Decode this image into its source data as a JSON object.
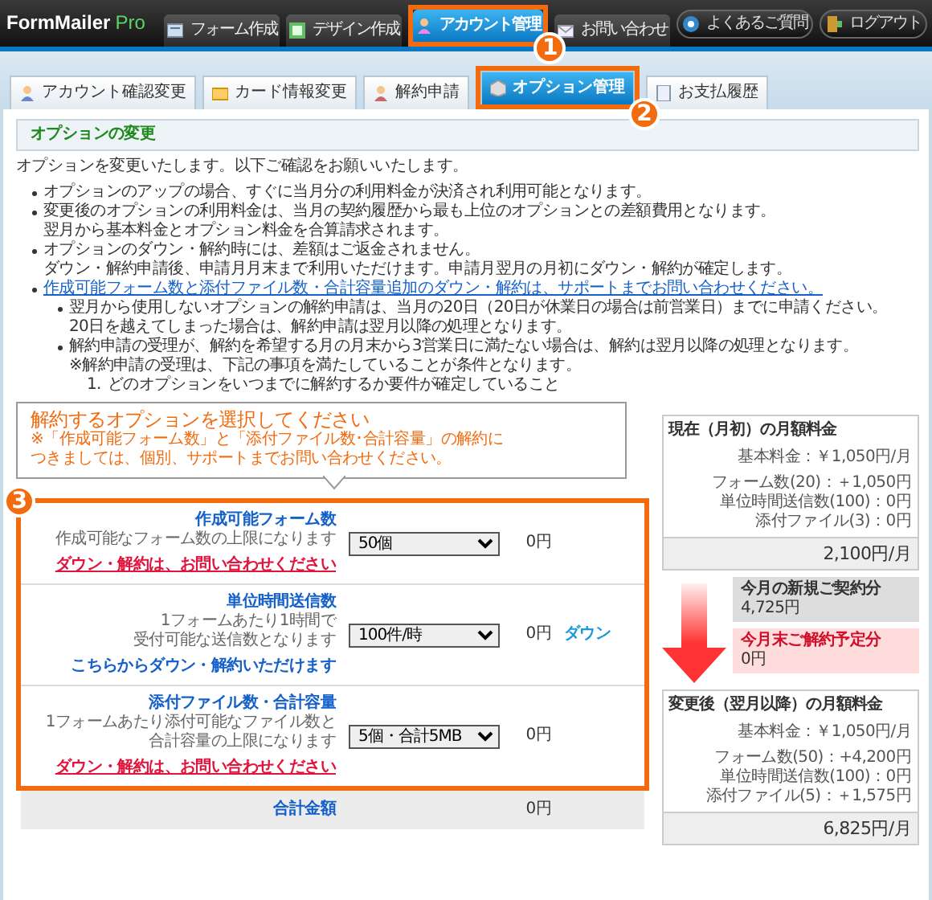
{
  "header": {
    "logo": {
      "main": "FormMailer",
      "suffix": "Pro"
    },
    "nav": [
      {
        "label": "フォーム作成",
        "selected": false
      },
      {
        "label": "デザイン作成",
        "selected": false
      },
      {
        "label": "アカウント管理",
        "selected": true,
        "annotation": "1"
      },
      {
        "label": "お問い合わせ",
        "selected": false
      }
    ],
    "utility_buttons": [
      "よくあるご質問",
      "ログアウト"
    ]
  },
  "subtabs": [
    {
      "label": "アカウント確認変更",
      "selected": false
    },
    {
      "label": "カード情報変更",
      "selected": false
    },
    {
      "label": "解約申請",
      "selected": false
    },
    {
      "label": "オプション管理",
      "selected": true,
      "annotation": "2"
    },
    {
      "label": "お支払履歴",
      "selected": false
    }
  ],
  "section": {
    "title": "オプションの変更",
    "intro": "オプションを変更いたします。以下ご確認をお願いいたします。",
    "notes": [
      {
        "kind": "text",
        "lines": [
          "オプションのアップの場合、すぐに当月分の利用料金が決済され利用可能となります。"
        ]
      },
      {
        "kind": "text",
        "lines": [
          "変更後のオプションの利用料金は、当月の契約履歴から最も上位のオプションとの差額費用となります。",
          "翌月から基本料金とオプション料金を合算請求されます。"
        ]
      },
      {
        "kind": "text",
        "lines": [
          "オプションのダウン・解約時には、差額はご返金されません。",
          "ダウン・解約申請後、申請月月末まで利用いただけます。申請月翌月の月初にダウン・解約が確定します。"
        ]
      },
      {
        "kind": "link",
        "lines": [
          "作成可能フォーム数と添付ファイル数・合計容量追加のダウン・解約は、サポートまでお問い合わせください。"
        ]
      }
    ],
    "subnotes": [
      {
        "lines": [
          "翌月から使用しないオプションの解約申請は、当月の20日（20日が休業日の場合は前営業日）までに申請ください。",
          "20日を越えてしまった場合は、解約申請は翌月以降の処理となります。"
        ]
      },
      {
        "lines": [
          "解約申請の受理が、解約を希望する月の月末から3営業日に満たない場合は、解約は翌月以降の処理となります。",
          "※解約申請の受理は、下記の事項を満たしていることが条件となります。"
        ]
      }
    ],
    "numbered": [
      {
        "number": "1.",
        "text": "どのオプションをいつまでに解約するか要件が確定していること"
      }
    ]
  },
  "callout": {
    "title": "解約するオプションを選択してください",
    "lines": [
      "※「作成可能フォーム数」と「添付ファイル数･合計容量」の解約に",
      "つきましては、個別、サポートまでお問い合わせください。"
    ]
  },
  "options": {
    "annotation": "3",
    "rows": [
      {
        "title": "作成可能フォーム数",
        "description": [
          "作成可能なフォーム数の上限になります"
        ],
        "link": "ダウン・解約は、お問い合わせください",
        "kind": "alert",
        "value": "50個",
        "price": "0円"
      },
      {
        "title": "単位時間送信数",
        "description": [
          "1フォームあたり1時間で",
          "受付可能な送信数となります"
        ],
        "link": "こちらからダウン・解約いただけます",
        "kind": "action",
        "value": "100件/時",
        "price": "0円",
        "extra": "ダウン"
      },
      {
        "title": "添付ファイル数・合計容量",
        "description": [
          "1フォームあたり添付可能なファイル数と",
          "合計容量の上限になります"
        ],
        "link": "ダウン・解約は、お問い合わせください",
        "kind": "alert",
        "value": "5個・合計5MB",
        "price": "0円"
      }
    ],
    "total": {
      "label": "合計金額",
      "value": "0円"
    }
  },
  "summary": {
    "current": {
      "title": "現在（月初）の月額料金",
      "base": "基本料金：￥1,050円/月",
      "items": [
        "フォーム数(20)：＋1,050円",
        "単位時間送信数(100)：0円",
        "添付ファイル(3)：0円"
      ],
      "total": "2,100円/月"
    },
    "changes": [
      {
        "kind": "new",
        "label": "今月の新規ご契約分",
        "value": "4,725円"
      },
      {
        "kind": "cancel",
        "label": "今月末ご解約予定分",
        "value": "0円"
      }
    ],
    "after": {
      "title": "変更後（翌月以降）の月額料金",
      "base": "基本料金：￥1,050円/月",
      "items": [
        "フォーム数(50)：+4,200円",
        "単位時間送信数(100)：0円",
        "添付ファイル(5)：＋1,575円"
      ],
      "total": "6,825円/月"
    }
  }
}
